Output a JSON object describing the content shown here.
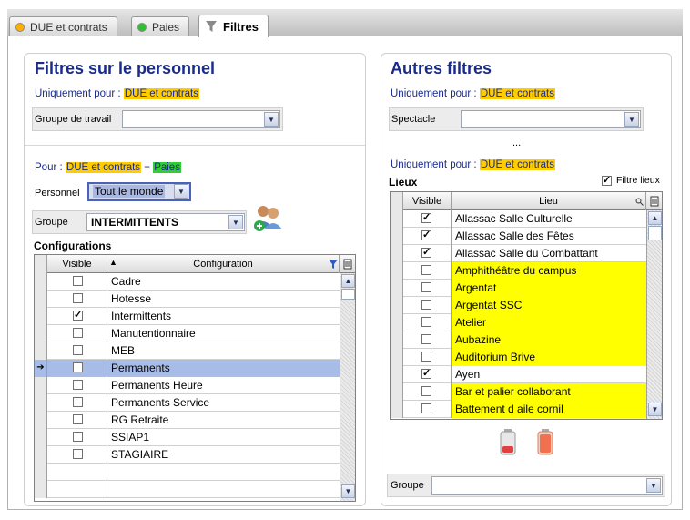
{
  "tabs": [
    {
      "label": "DUE et contrats",
      "icon": "orange-dot-icon"
    },
    {
      "label": "Paies",
      "icon": "green-dot-icon"
    },
    {
      "label": "Filtres",
      "icon": "filter-icon",
      "active": true
    }
  ],
  "left": {
    "title": "Filtres sur le personnel",
    "uniquement_label": "Uniquement pour :",
    "uniquement_value": "DUE et contrats",
    "groupe_travail_label": "Groupe de travail",
    "groupe_travail_value": "",
    "pour_label": "Pour :",
    "pour_value1": "DUE et contrats",
    "pour_plus": "+",
    "pour_value2": "Paies",
    "personnel_label": "Personnel",
    "personnel_value": "Tout le monde",
    "groupe_label": "Groupe",
    "groupe_value": "INTERMITTENTS",
    "configurations_heading": "Configurations",
    "grid_headers": {
      "visible": "Visible",
      "configuration": "Configuration"
    },
    "rows": [
      {
        "label": "Cadre",
        "checked": false
      },
      {
        "label": "Hotesse",
        "checked": false
      },
      {
        "label": "Intermittents",
        "checked": true
      },
      {
        "label": "Manutentionnaire",
        "checked": false
      },
      {
        "label": "MEB",
        "checked": false
      },
      {
        "label": "Permanents",
        "checked": false,
        "selected": true
      },
      {
        "label": "Permanents Heure",
        "checked": false
      },
      {
        "label": "Permanents Service",
        "checked": false
      },
      {
        "label": "RG Retraite",
        "checked": false
      },
      {
        "label": "SSIAP1",
        "checked": false
      },
      {
        "label": "STAGIAIRE",
        "checked": false
      },
      {
        "label": "",
        "checked": null
      },
      {
        "label": "",
        "checked": null
      }
    ]
  },
  "right": {
    "title": "Autres filtres",
    "uniquement_label": "Uniquement pour :",
    "uniquement_value": "DUE et contrats",
    "spectacle_label": "Spectacle",
    "spectacle_value": "",
    "ellipsis": "...",
    "uniquement2_label": "Uniquement pour :",
    "uniquement2_value": "DUE et contrats",
    "lieux_heading": "Lieux",
    "filtre_lieux_label": "Filtre lieux",
    "filtre_lieux_checked": true,
    "grid_headers": {
      "visible": "Visible",
      "lieu": "Lieu"
    },
    "rows": [
      {
        "label": "Allassac Salle Culturelle",
        "checked": true,
        "highlight": false
      },
      {
        "label": "Allassac Salle des Fêtes",
        "checked": true,
        "highlight": false
      },
      {
        "label": "Allassac Salle du Combattant",
        "checked": true,
        "highlight": false
      },
      {
        "label": "Amphithéâtre du campus",
        "checked": false,
        "highlight": true
      },
      {
        "label": "Argentat",
        "checked": false,
        "highlight": true
      },
      {
        "label": "Argentat SSC",
        "checked": false,
        "highlight": true
      },
      {
        "label": "Atelier",
        "checked": false,
        "highlight": true
      },
      {
        "label": "Aubazine",
        "checked": false,
        "highlight": true
      },
      {
        "label": "Auditorium Brive",
        "checked": false,
        "highlight": true
      },
      {
        "label": "Ayen",
        "checked": true,
        "highlight": false
      },
      {
        "label": "Bar et palier collaborant",
        "checked": false,
        "highlight": true
      },
      {
        "label": "Battement d aile cornil",
        "checked": false,
        "highlight": true
      }
    ],
    "groupe_label": "Groupe",
    "groupe_value": ""
  },
  "colors": {
    "title": "#1a2b8c",
    "highlight_orange": "#ffcc00",
    "highlight_green": "#33cc33",
    "highlight_yellow": "#ffff00",
    "selection": "#a8bce8"
  }
}
